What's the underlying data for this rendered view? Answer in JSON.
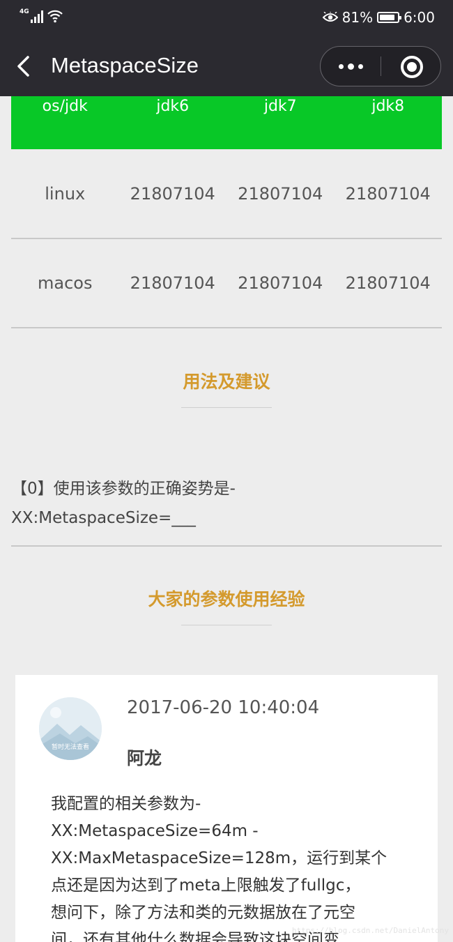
{
  "status_bar": {
    "network": "4G",
    "battery_percent": "81%",
    "battery_level": 0.81,
    "time": "6:00"
  },
  "nav": {
    "title": "MetaspaceSize",
    "icons": [
      "back-icon",
      "more-dots-icon",
      "close-circle-icon"
    ]
  },
  "table": {
    "headers": [
      "os/jdk",
      "jdk6",
      "jdk7",
      "jdk8"
    ],
    "rows": [
      [
        "linux",
        "21807104",
        "21807104",
        "21807104"
      ],
      [
        "macos",
        "21807104",
        "21807104",
        "21807104"
      ]
    ],
    "header_color": "#08c827"
  },
  "sections": {
    "usage_title": "用法及建议",
    "usage_text_line1": "【0】使用该参数的正确姿势是-",
    "usage_text_line2": "XX:MetaspaceSize=___",
    "experience_title": "大家的参数使用经验",
    "accent_color": "#d49a2d"
  },
  "comment": {
    "avatar_caption": "暂时无法查看",
    "time": "2017-06-20 10:40:04",
    "author": "阿龙",
    "body_lines": [
      "我配置的相关参数为-",
      "XX:MetaspaceSize=64m -",
      "XX:MaxMetaspaceSize=128m，运行到某个",
      "点还是因为达到了meta上限触发了fullgc，",
      "想问下，除了方法和类的元数据放在了元空",
      "间，还有其他什么数据会导致这块空间变"
    ]
  },
  "watermark": "https://blog.csdn.net/DanielAntony"
}
